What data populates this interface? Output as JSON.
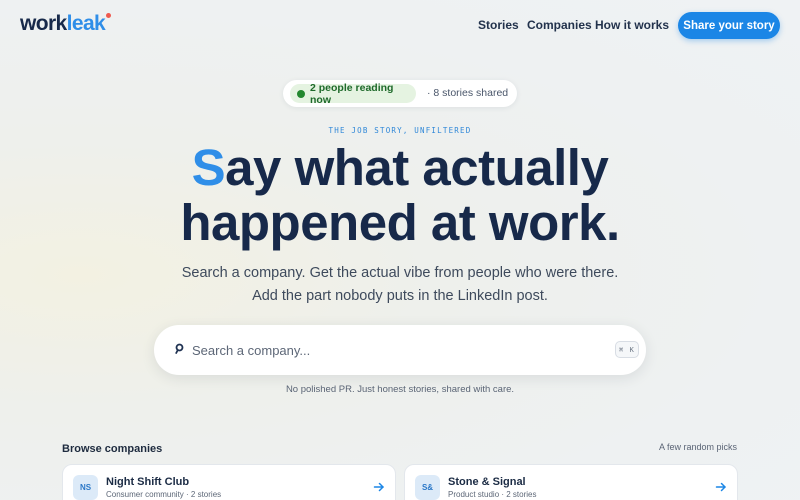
{
  "nav": {
    "logo_main": "work",
    "logo_accent": "leak",
    "links": [
      "Stories",
      "Companies",
      "How it works"
    ],
    "cta": "Share your story"
  },
  "hero": {
    "live_status": "2 people reading now",
    "stories_count": "· 8 stories shared",
    "eyebrow": "THE JOB STORY, UNFILTERED",
    "headline_first_letter": "S",
    "headline_line1_rest": "ay what actually",
    "headline_line2": "happened at work.",
    "subtitle_line1": "Search a company. Get the actual vibe from people who were there.",
    "subtitle_line2": "Add the part nobody puts in the LinkedIn post."
  },
  "search": {
    "placeholder": "Search a company...",
    "shortcut": "⌘ K",
    "tagline": "No polished PR. Just honest stories, shared with care."
  },
  "browse": {
    "title": "Browse companies",
    "hint": "A few random picks",
    "cards": [
      {
        "initials": "NS",
        "name": "Night Shift Club",
        "meta": "Consumer community · 2 stories"
      },
      {
        "initials": "S&",
        "name": "Stone & Signal",
        "meta": "Product studio · 2 stories"
      }
    ]
  },
  "colors": {
    "accent": "#1b86e6",
    "brand_dark": "#17294a",
    "live_green": "#23882f",
    "logo_dot": "#ef5a4f"
  },
  "icons": {
    "search": "search-icon",
    "arrow": "arrow-right-icon"
  }
}
